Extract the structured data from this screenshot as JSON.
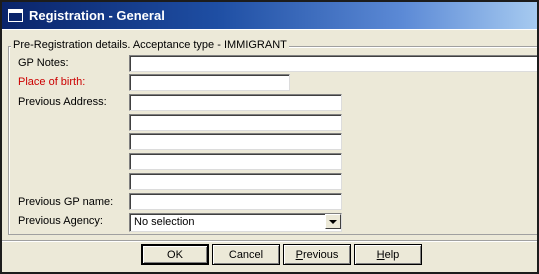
{
  "window": {
    "title": "Registration - General"
  },
  "group": {
    "legend": "Pre-Registration details. Acceptance type - IMMIGRANT"
  },
  "fields": {
    "gp_notes": {
      "label": "GP Notes:",
      "value": ""
    },
    "place_of_birth": {
      "label": "Place of birth:",
      "value": ""
    },
    "previous_address": {
      "label": "Previous Address:",
      "lines": [
        "",
        "",
        "",
        "",
        ""
      ]
    },
    "previous_gp_name": {
      "label": "Previous GP name:",
      "value": ""
    },
    "previous_agency": {
      "label": "Previous Agency:",
      "selected": "No selection"
    }
  },
  "buttons": {
    "ok": "OK",
    "cancel": "Cancel",
    "previous_mnemonic": "P",
    "previous_rest": "revious",
    "help_mnemonic": "H",
    "help_rest": "elp"
  },
  "colors": {
    "titlebar_start": "#0a246a",
    "titlebar_end": "#a6caf0",
    "dialog_bg": "#ece9d8",
    "required_label": "#cc0000"
  },
  "icons": {
    "title_icon": "window-icon",
    "dropdown_arrow": "chevron-down-icon"
  }
}
